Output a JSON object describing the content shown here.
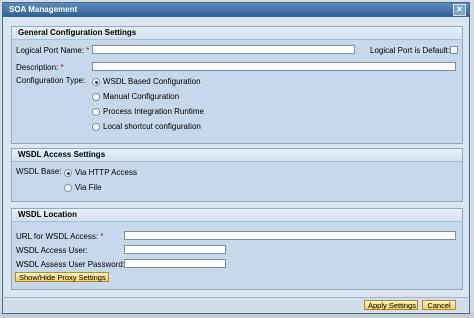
{
  "dialog": {
    "title": "SOA Management",
    "close_glyph": "✕"
  },
  "general": {
    "header": "General Configuration Settings",
    "logical_port_name_label": "Logical Port Name:",
    "logical_port_name_value": "",
    "default_label": "Logical Port is Default:",
    "default_checked": false,
    "description_label": "Description:",
    "description_value": "",
    "required_marker": "*",
    "config_type_label": "Configuration Type:",
    "options": [
      {
        "label": "WSDL Based Configuration",
        "selected": true
      },
      {
        "label": "Manual Configuration",
        "selected": false
      },
      {
        "label": "Process Integration Runtime",
        "selected": false
      },
      {
        "label": "Local shortcut configuration",
        "selected": false
      }
    ]
  },
  "wsdl_access": {
    "header": "WSDL Access Settings",
    "base_label": "WSDL Base:",
    "options": [
      {
        "label": "Via HTTP Access",
        "selected": true
      },
      {
        "label": "Via File",
        "selected": false
      }
    ]
  },
  "wsdl_location": {
    "header": "WSDL Location",
    "url_label": "URL for WSDL Access:",
    "url_value": "",
    "user_label": "WSDL Access User:",
    "user_value": "",
    "password_label": "WSDL Assess User Password:",
    "password_value": "",
    "proxy_button": "Show/Hide Proxy Settings"
  },
  "footer": {
    "apply_button": "Apply Settings",
    "cancel_button": "Cancel"
  }
}
